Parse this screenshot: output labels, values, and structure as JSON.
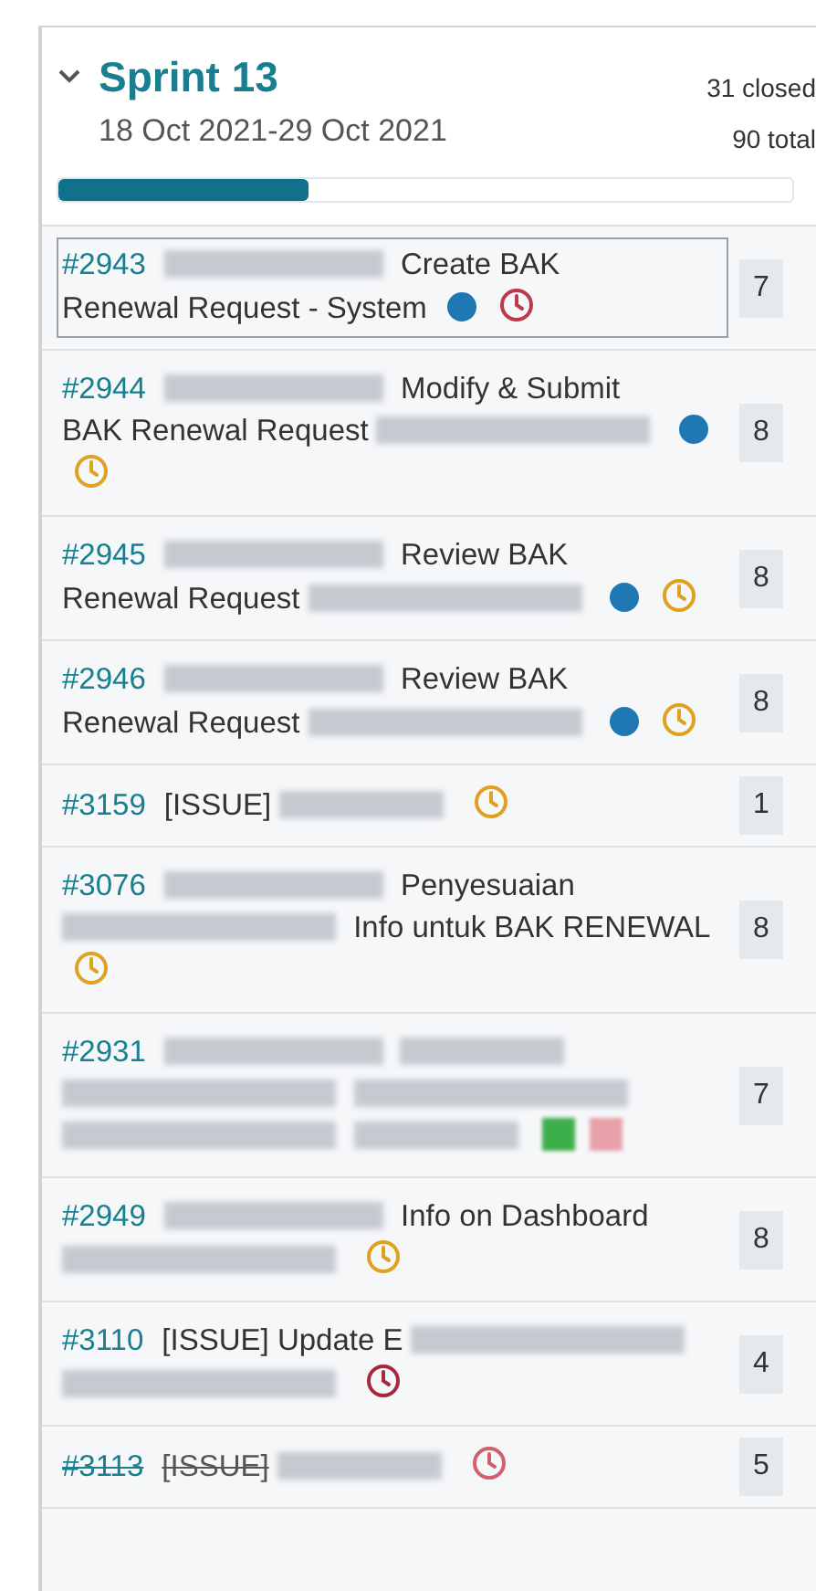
{
  "sprint": {
    "title": "Sprint 13",
    "expanded": true,
    "dates": "18 Oct 2021-29 Oct 2021",
    "closed": "31 closed",
    "total": "90 total",
    "level": 0.34
  },
  "tasks": [
    {
      "id": "#2943",
      "selected": true,
      "closed": false,
      "segments": [
        {
          "kind": "redacted"
        },
        {
          "kind": "text",
          "text": "Create BAK"
        },
        {
          "kind": "text",
          "text": "Renewal Request - System"
        }
      ],
      "markers": [
        {
          "kind": "dot",
          "color": "#1f77b4"
        },
        {
          "kind": "clock",
          "color": "#c0394b"
        }
      ],
      "points": "7"
    },
    {
      "id": "#2944",
      "selected": false,
      "closed": false,
      "segments": [
        {
          "kind": "redacted"
        },
        {
          "kind": "text",
          "text": "Modify & Submit"
        },
        {
          "kind": "text",
          "text": "BAK Renewal Request"
        },
        {
          "kind": "redacted"
        }
      ],
      "markers": [
        {
          "kind": "dot",
          "color": "#1f77b4"
        },
        {
          "kind": "clock",
          "color": "#e0a020"
        }
      ],
      "points": "8"
    },
    {
      "id": "#2945",
      "selected": false,
      "closed": false,
      "segments": [
        {
          "kind": "redacted"
        },
        {
          "kind": "text",
          "text": "Review BAK"
        },
        {
          "kind": "text",
          "text": "Renewal Request"
        },
        {
          "kind": "redacted"
        }
      ],
      "markers": [
        {
          "kind": "dot",
          "color": "#1f77b4"
        },
        {
          "kind": "clock",
          "color": "#e0a020"
        }
      ],
      "points": "8"
    },
    {
      "id": "#2946",
      "selected": false,
      "closed": false,
      "segments": [
        {
          "kind": "redacted"
        },
        {
          "kind": "text",
          "text": "Review BAK"
        },
        {
          "kind": "text",
          "text": "Renewal Request"
        },
        {
          "kind": "redacted"
        }
      ],
      "markers": [
        {
          "kind": "dot",
          "color": "#1f77b4"
        },
        {
          "kind": "clock",
          "color": "#e0a020"
        }
      ],
      "points": "8"
    },
    {
      "id": "#3159",
      "selected": false,
      "closed": false,
      "segments": [
        {
          "kind": "text",
          "text": "[ISSUE]"
        },
        {
          "kind": "redacted"
        }
      ],
      "markers": [
        {
          "kind": "clock",
          "color": "#e0a020"
        }
      ],
      "points": "1"
    },
    {
      "id": "#3076",
      "selected": false,
      "closed": false,
      "segments": [
        {
          "kind": "redacted"
        },
        {
          "kind": "text",
          "text": "Penyesuaian"
        },
        {
          "kind": "redacted"
        },
        {
          "kind": "text",
          "text": "Info untuk BAK RENEWAL"
        }
      ],
      "markers": [
        {
          "kind": "clock",
          "color": "#e0a020"
        }
      ],
      "points": "8"
    },
    {
      "id": "#2931",
      "selected": false,
      "closed": false,
      "segments": [
        {
          "kind": "redacted"
        },
        {
          "kind": "redacted"
        },
        {
          "kind": "redacted"
        },
        {
          "kind": "redacted"
        },
        {
          "kind": "redacted"
        },
        {
          "kind": "redacted"
        }
      ],
      "markers": [
        {
          "kind": "tag",
          "color": "#3cae4a"
        },
        {
          "kind": "tag",
          "color": "#e8a0a8"
        }
      ],
      "points": "7"
    },
    {
      "id": "#2949",
      "selected": false,
      "closed": false,
      "segments": [
        {
          "kind": "redacted"
        },
        {
          "kind": "text",
          "text": "Info on"
        },
        {
          "kind": "text",
          "text": "Dashboard"
        },
        {
          "kind": "redacted"
        }
      ],
      "markers": [
        {
          "kind": "clock",
          "color": "#e0a020"
        }
      ],
      "points": "8"
    },
    {
      "id": "#3110",
      "selected": false,
      "closed": false,
      "segments": [
        {
          "kind": "text",
          "text": "[ISSUE]"
        },
        {
          "kind": "text",
          "text": "Update E"
        },
        {
          "kind": "redacted"
        },
        {
          "kind": "redacted"
        }
      ],
      "markers": [
        {
          "kind": "clock",
          "color": "#a8283c"
        }
      ],
      "points": "4"
    },
    {
      "id": "#3113",
      "selected": false,
      "closed": true,
      "segments": [
        {
          "kind": "text",
          "text": "[ISSUE]"
        },
        {
          "kind": "redacted"
        }
      ],
      "markers": [
        {
          "kind": "clock",
          "color": "#d06070"
        }
      ],
      "points": "5"
    }
  ]
}
